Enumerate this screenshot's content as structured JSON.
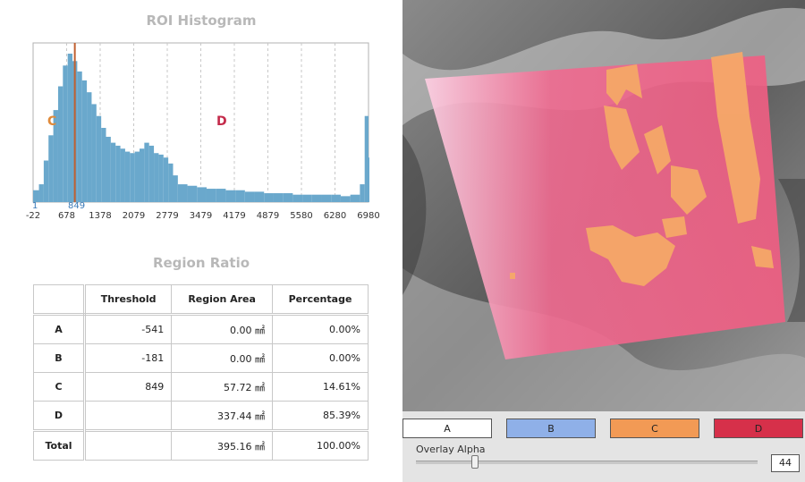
{
  "histogram": {
    "title": "ROI Histogram",
    "x_ticks": [
      "-22",
      "678",
      "1378",
      "2079",
      "2779",
      "3479",
      "4179",
      "4879",
      "5580",
      "6280",
      "6980"
    ],
    "threshold_low_label": "1",
    "threshold_label": "849",
    "region_c_label": "C",
    "region_d_label": "D",
    "colors": {
      "bars": "#6aa8cc",
      "threshold_line": "#c06030",
      "region_c": "#e08a3a",
      "region_d": "#c42a4a"
    }
  },
  "chart_data": {
    "type": "bar",
    "title": "ROI Histogram",
    "x_range": [
      -22,
      6980
    ],
    "x_ticks": [
      -22,
      678,
      1378,
      2079,
      2779,
      3479,
      4179,
      4879,
      5580,
      6280,
      6980
    ],
    "threshold": 849,
    "bins": [
      {
        "x": -22,
        "y": 8
      },
      {
        "x": 100,
        "y": 12
      },
      {
        "x": 200,
        "y": 28
      },
      {
        "x": 300,
        "y": 45
      },
      {
        "x": 400,
        "y": 62
      },
      {
        "x": 500,
        "y": 78
      },
      {
        "x": 600,
        "y": 92
      },
      {
        "x": 700,
        "y": 100
      },
      {
        "x": 800,
        "y": 95
      },
      {
        "x": 900,
        "y": 88
      },
      {
        "x": 1000,
        "y": 82
      },
      {
        "x": 1100,
        "y": 74
      },
      {
        "x": 1200,
        "y": 66
      },
      {
        "x": 1300,
        "y": 58
      },
      {
        "x": 1400,
        "y": 50
      },
      {
        "x": 1500,
        "y": 44
      },
      {
        "x": 1600,
        "y": 40
      },
      {
        "x": 1700,
        "y": 38
      },
      {
        "x": 1800,
        "y": 36
      },
      {
        "x": 1900,
        "y": 34
      },
      {
        "x": 2000,
        "y": 33
      },
      {
        "x": 2100,
        "y": 34
      },
      {
        "x": 2200,
        "y": 36
      },
      {
        "x": 2300,
        "y": 40
      },
      {
        "x": 2400,
        "y": 38
      },
      {
        "x": 2500,
        "y": 33
      },
      {
        "x": 2600,
        "y": 32
      },
      {
        "x": 2700,
        "y": 30
      },
      {
        "x": 2800,
        "y": 26
      },
      {
        "x": 2900,
        "y": 18
      },
      {
        "x": 3000,
        "y": 12
      },
      {
        "x": 3200,
        "y": 11
      },
      {
        "x": 3400,
        "y": 10
      },
      {
        "x": 3600,
        "y": 9
      },
      {
        "x": 3800,
        "y": 9
      },
      {
        "x": 4000,
        "y": 8
      },
      {
        "x": 4200,
        "y": 8
      },
      {
        "x": 4400,
        "y": 7
      },
      {
        "x": 4600,
        "y": 7
      },
      {
        "x": 4800,
        "y": 6
      },
      {
        "x": 5000,
        "y": 6
      },
      {
        "x": 5200,
        "y": 6
      },
      {
        "x": 5400,
        "y": 5
      },
      {
        "x": 5600,
        "y": 5
      },
      {
        "x": 5800,
        "y": 5
      },
      {
        "x": 6000,
        "y": 5
      },
      {
        "x": 6200,
        "y": 5
      },
      {
        "x": 6400,
        "y": 4
      },
      {
        "x": 6600,
        "y": 5
      },
      {
        "x": 6800,
        "y": 12
      },
      {
        "x": 6900,
        "y": 58
      },
      {
        "x": 6980,
        "y": 30
      }
    ]
  },
  "ratio": {
    "title": "Region Ratio",
    "headers": [
      "",
      "Threshold",
      "Region Area",
      "Percentage"
    ],
    "rows": [
      {
        "label": "A",
        "threshold": "-541",
        "area": "0.00 ㎟",
        "pct": "0.00%"
      },
      {
        "label": "B",
        "threshold": "-181",
        "area": "0.00 ㎟",
        "pct": "0.00%"
      },
      {
        "label": "C",
        "threshold": "849",
        "area": "57.72 ㎟",
        "pct": "14.61%"
      },
      {
        "label": "D",
        "threshold": "",
        "area": "337.44 ㎟",
        "pct": "85.39%"
      }
    ],
    "total": {
      "label": "Total",
      "threshold": "",
      "area": "395.16 ㎟",
      "pct": "100.00%"
    }
  },
  "viewer": {
    "region_buttons": [
      {
        "label": "A",
        "color": "#ffffff"
      },
      {
        "label": "B",
        "color": "#8fb0e8"
      },
      {
        "label": "C",
        "color": "#f29a55"
      },
      {
        "label": "D",
        "color": "#d6304a"
      }
    ],
    "overlay_alpha_label": "Overlay Alpha",
    "overlay_alpha_value": "44",
    "overlay_alpha_fraction": 0.44
  }
}
